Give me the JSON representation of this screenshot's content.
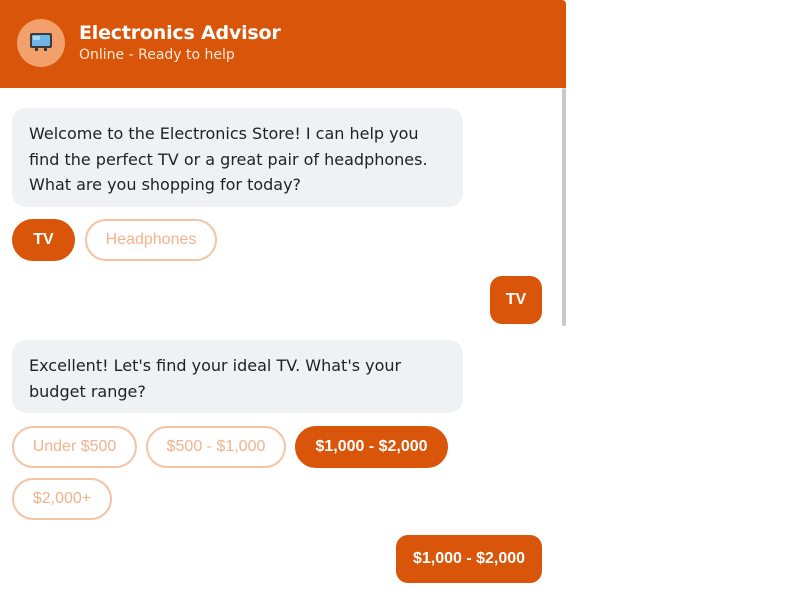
{
  "header": {
    "title": "Electronics Advisor",
    "status": "Online - Ready to help"
  },
  "messages": {
    "welcome": "Welcome to the Electronics Store! I can help you find the perfect TV or a great pair of headphones. What are you shopping for today?",
    "reply_1": "TV",
    "budget_question": "Excellent! Let's find your ideal TV. What's your budget range?",
    "reply_2": "$1,000 - $2,000"
  },
  "options": {
    "product": [
      "TV",
      "Headphones"
    ],
    "product_selected": "TV",
    "budget": [
      "Under $500",
      "$500 - $1,000",
      "$1,000 - $2,000",
      "$2,000+"
    ],
    "budget_selected": "$1,000 - $2,000"
  },
  "colors": {
    "accent": "#d95509",
    "bot_bubble": "#f0f1f5",
    "chip_outline": "#f4c3a3"
  },
  "icons": {
    "avatar": "tv-icon"
  }
}
